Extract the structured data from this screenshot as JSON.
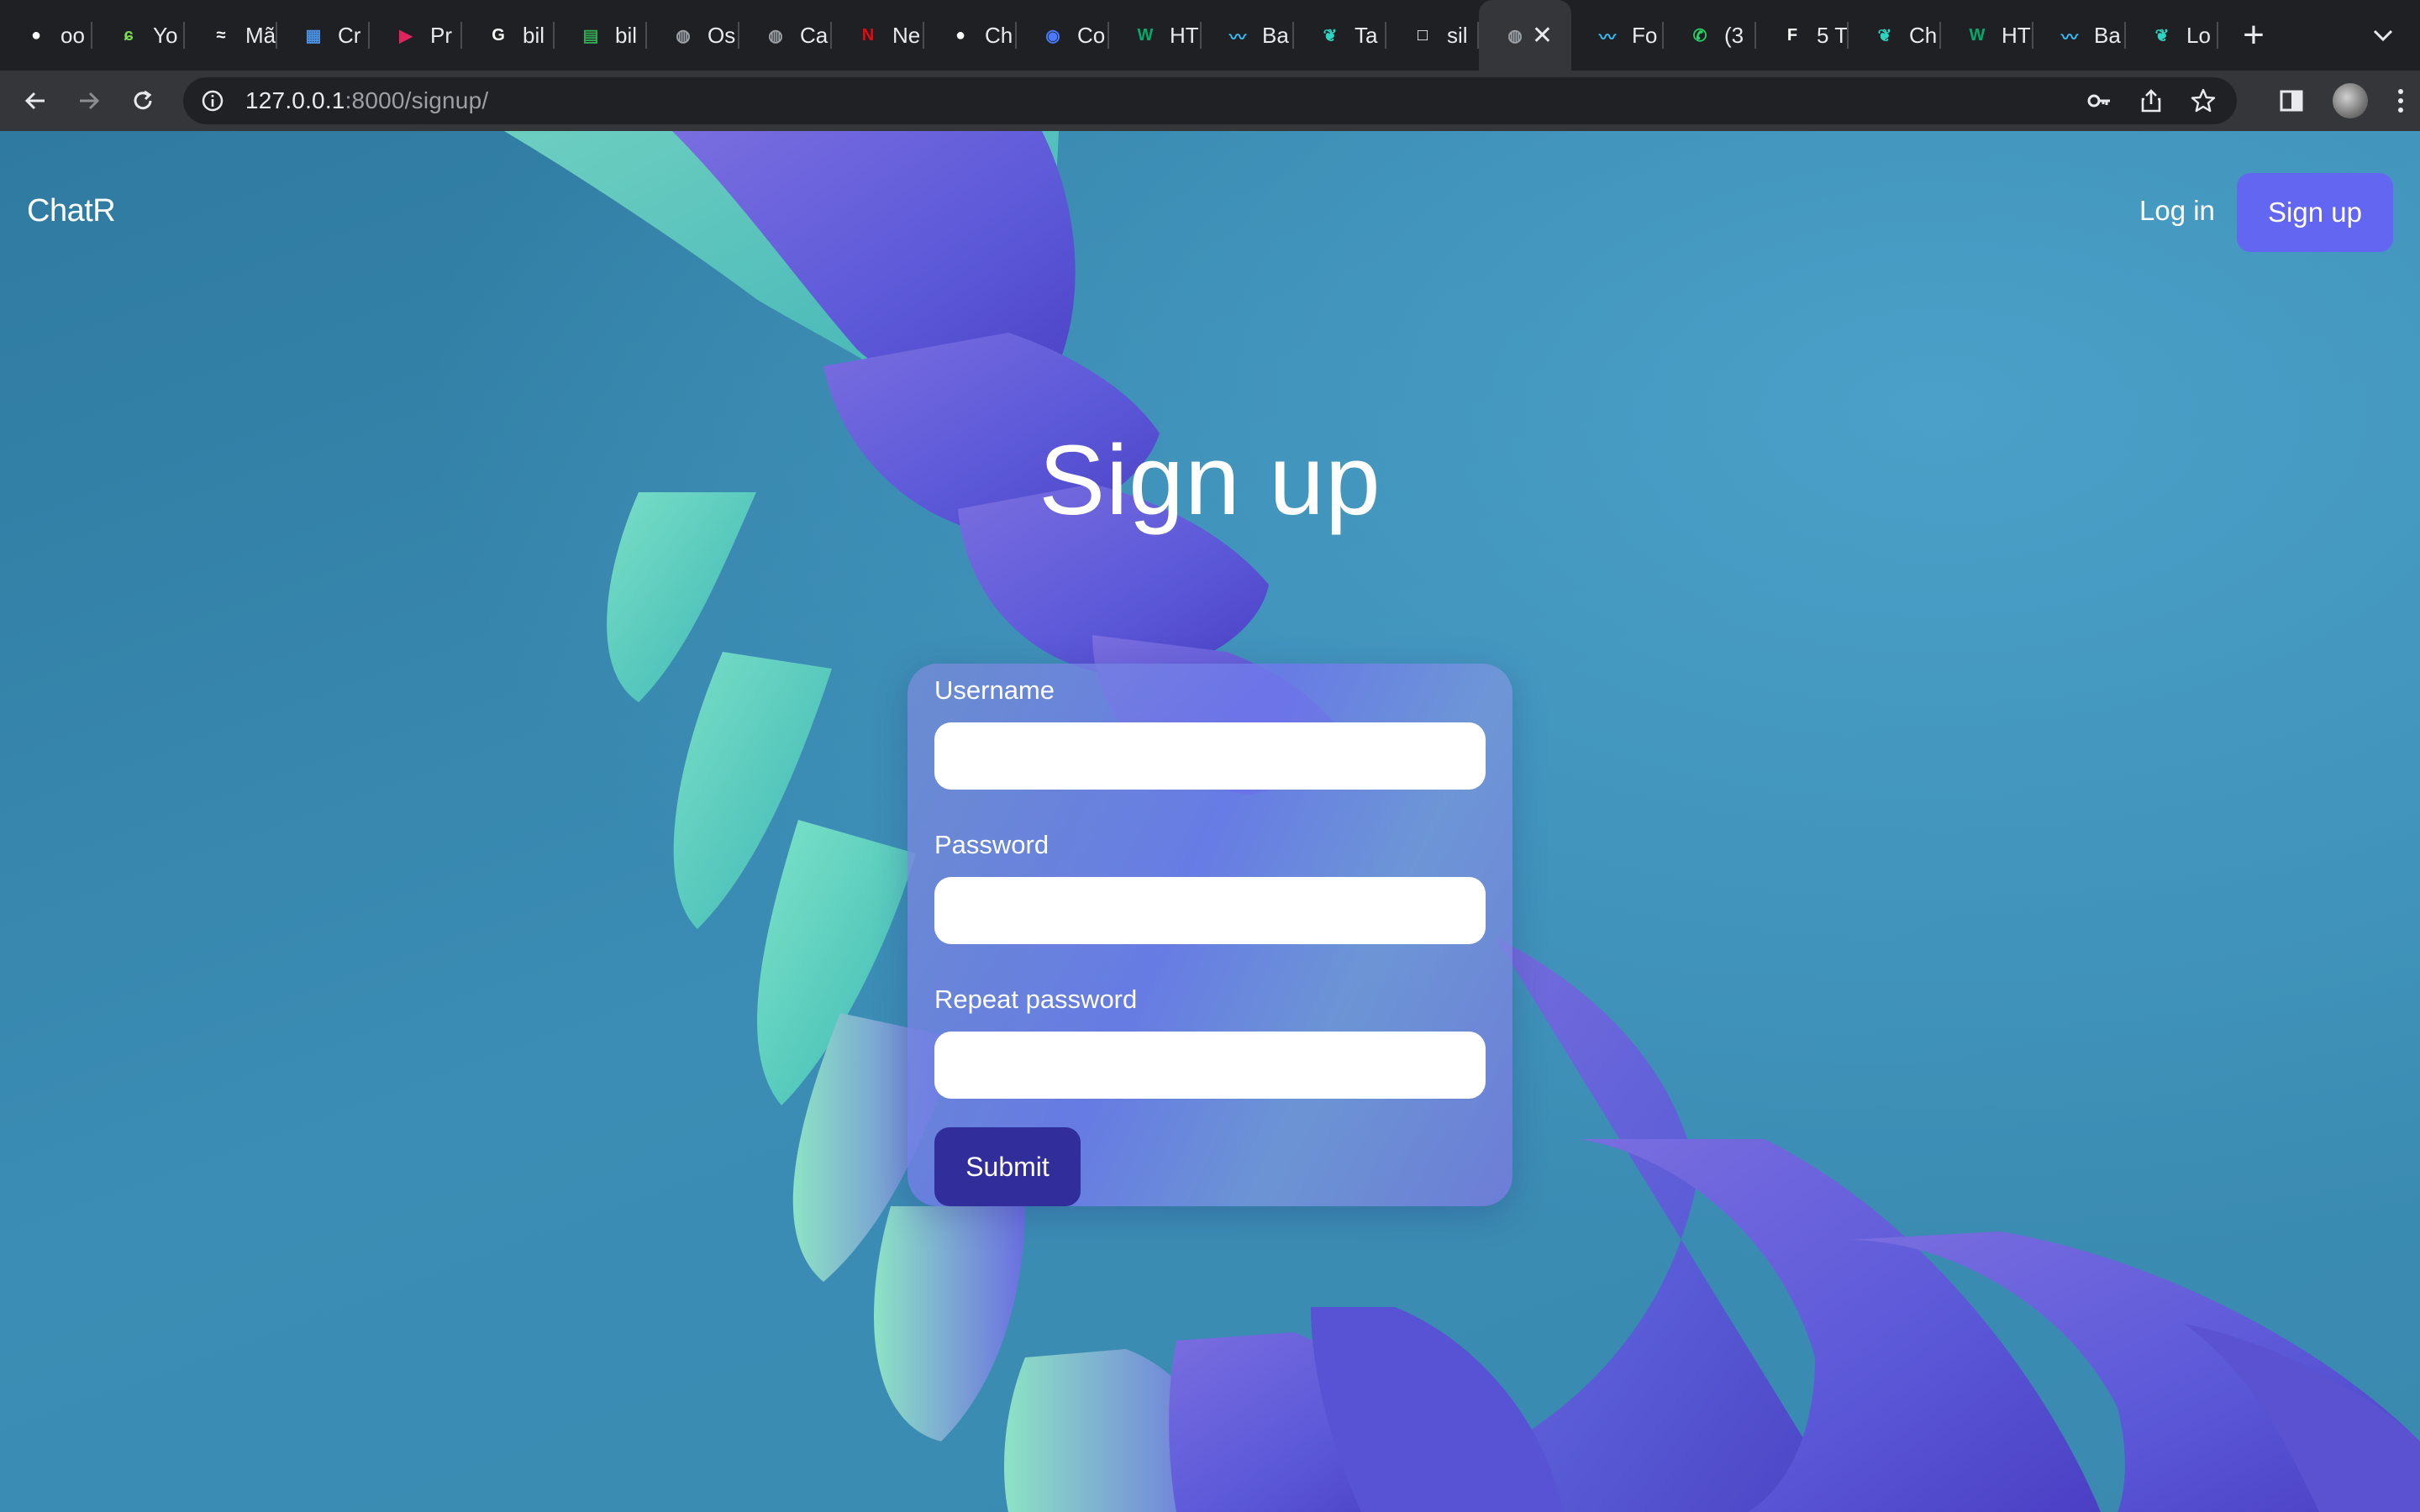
{
  "browser": {
    "tabs": [
      {
        "label": "oo",
        "icon": "github-icon",
        "color": "#ffffff"
      },
      {
        "label": "Yo",
        "icon": "leaf-swirl-icon",
        "color": "#7ed957"
      },
      {
        "label": "Mã",
        "icon": "cloud-wave-icon",
        "color": "#ffffff"
      },
      {
        "label": "Cr",
        "icon": "layout-icon",
        "color": "#4a90e2"
      },
      {
        "label": "Pr",
        "icon": "play-arrow-icon",
        "color": "#e0245e"
      },
      {
        "label": "bil",
        "icon": "google-icon",
        "color": "#ffffff"
      },
      {
        "label": "bil",
        "icon": "sheets-icon",
        "color": "#34a853"
      },
      {
        "label": "Os",
        "icon": "globe-icon",
        "color": "#9aa0a6"
      },
      {
        "label": "Ca",
        "icon": "globe-icon",
        "color": "#9aa0a6"
      },
      {
        "label": "Ne",
        "icon": "netflix-icon",
        "color": "#e50914"
      },
      {
        "label": "Ch",
        "icon": "github-icon",
        "color": "#ffffff"
      },
      {
        "label": "Co",
        "icon": "chatbot-icon",
        "color": "#4a7bff"
      },
      {
        "label": "HT",
        "icon": "w3-icon",
        "color": "#04aa6d"
      },
      {
        "label": "Ba",
        "icon": "tailwind-icon",
        "color": "#38bdf8"
      },
      {
        "label": "Ta",
        "icon": "leaf-icon",
        "color": "#2dd4bf"
      },
      {
        "label": "sil",
        "icon": "square-outline-icon",
        "color": "#ffffff"
      },
      {
        "label": "",
        "icon": "globe-icon",
        "color": "#9aa0a6",
        "active": true
      },
      {
        "label": "Fo",
        "icon": "tailwind-icon",
        "color": "#38bdf8"
      },
      {
        "label": "(3",
        "icon": "whatsapp-icon",
        "color": "#25d366"
      },
      {
        "label": "5 T",
        "icon": "f-icon",
        "color": "#ffffff"
      },
      {
        "label": "Ch",
        "icon": "leaf-icon",
        "color": "#2dd4bf"
      },
      {
        "label": "HT",
        "icon": "w3-icon",
        "color": "#04aa6d"
      },
      {
        "label": "Ba",
        "icon": "tailwind-icon",
        "color": "#38bdf8"
      },
      {
        "label": "Lo",
        "icon": "leaf-icon",
        "color": "#2dd4bf"
      }
    ],
    "url_host": "127.0.0.1",
    "url_rest": ":8000/signup/"
  },
  "nav": {
    "brand": "ChatR",
    "login_label": "Log in",
    "signup_label": "Sign up"
  },
  "main": {
    "heading": "Sign up",
    "form": {
      "username_label": "Username",
      "username_value": "",
      "password_label": "Password",
      "password_value": "",
      "repeat_label": "Repeat password",
      "repeat_value": "",
      "submit_label": "Submit"
    }
  },
  "colors": {
    "accent": "#6366f1",
    "submit": "#312e9c"
  }
}
